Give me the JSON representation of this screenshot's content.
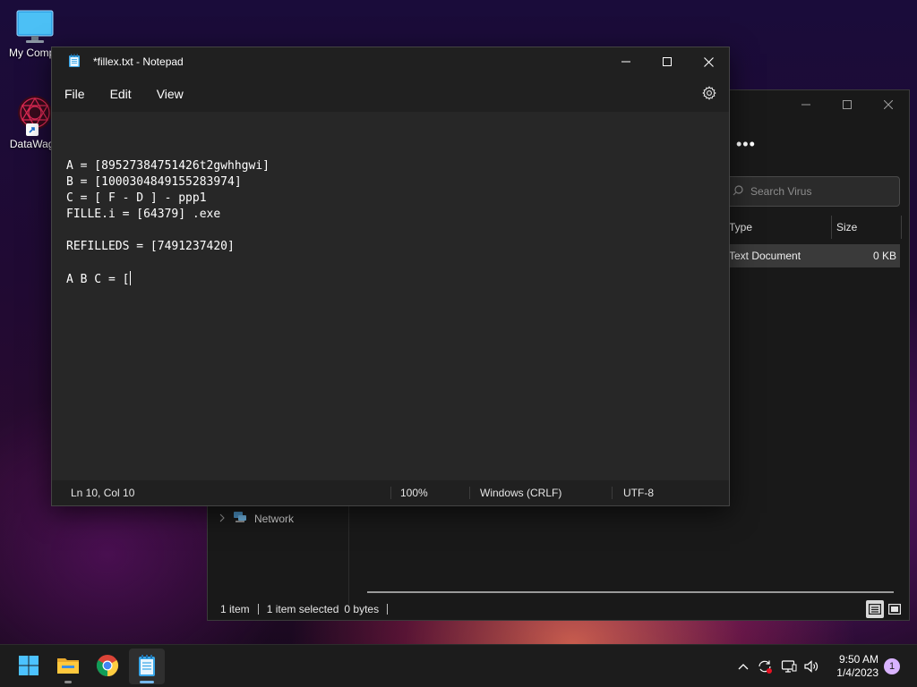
{
  "desktop": {
    "icons": [
      {
        "label": "My Compu",
        "icon": "computer-icon"
      },
      {
        "label": "DataWago",
        "icon": "datawagon-app-icon"
      }
    ]
  },
  "notepad": {
    "title": "*fillex.txt - Notepad",
    "menu": [
      "File",
      "Edit",
      "View"
    ],
    "content_lines": [
      "A = [89527384751426t2gwhhgwi]",
      "B = [1000304849155283974]",
      "C = [ F - D ] - ppp1",
      "FILLE.i = [64379] .exe",
      "",
      "REFILLEDS = [7491237420]",
      "",
      "A B C = ["
    ],
    "status": {
      "position": "Ln 10, Col 10",
      "zoom": "100%",
      "line_ending": "Windows (CRLF)",
      "encoding": "UTF-8"
    }
  },
  "explorer": {
    "more_label": "•••",
    "search_placeholder": "Search Virus",
    "columns": [
      "Type",
      "Size"
    ],
    "rows": [
      {
        "type": "Text Document",
        "size": "0 KB"
      }
    ],
    "nav": [
      {
        "label": "Network"
      }
    ],
    "status": {
      "items": "1 item",
      "selected": "1 item selected",
      "bytes": "0 bytes"
    }
  },
  "taskbar": {
    "apps": [
      {
        "icon": "windows-start-icon",
        "active": false
      },
      {
        "icon": "file-explorer-icon",
        "active": false
      },
      {
        "icon": "chrome-icon",
        "active": false
      },
      {
        "icon": "notepad-icon",
        "active": true
      }
    ],
    "tray": {
      "time": "9:50 AM",
      "date": "1/4/2023",
      "notification_count": "1"
    }
  },
  "colors": {
    "accent": "#76b9ed",
    "titlebar": "#202020",
    "editor_bg": "#272727",
    "badge": "#d9b3ff"
  }
}
